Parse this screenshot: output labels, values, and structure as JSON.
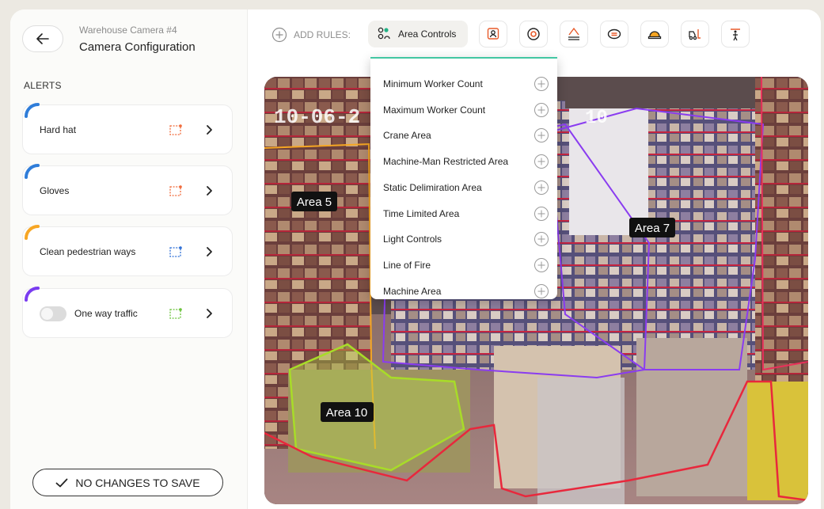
{
  "header": {
    "camera_name": "Warehouse Camera #4",
    "title": "Camera Configuration"
  },
  "sidebar": {
    "section_title": "ALERTS",
    "alerts": [
      {
        "label": "Hard hat",
        "accent": "#2f7dd9",
        "zone_color": "#f06a3a"
      },
      {
        "label": "Gloves",
        "accent": "#2f7dd9",
        "zone_color": "#f06a3a"
      },
      {
        "label": "Clean pedestrian ways",
        "accent": "#f7a623",
        "zone_color": "#2e6fd6"
      },
      {
        "label": "One way traffic",
        "accent": "#7a3cf0",
        "zone_color": "#6ac23a",
        "toggle": "off"
      }
    ],
    "save_label": "NO CHANGES TO SAVE"
  },
  "toolbar": {
    "add_rules_label": "ADD RULES:",
    "active_label": "Area Controls",
    "icons": [
      "worker-badge-icon",
      "eye-detection-icon",
      "crane-icon",
      "restricted-eye-icon",
      "hard-hat-icon",
      "forklift-icon",
      "pedestrian-sign-icon"
    ]
  },
  "dropdown": {
    "items": [
      "Minimum Worker Count",
      "Maximum Worker Count",
      "Crane Area",
      "Machine-Man Restricted Area",
      "Static Delimiration Area",
      "Time Limited Area",
      "Light Controls",
      "Line of Fire",
      "Machine Area"
    ]
  },
  "video": {
    "timestamp": "10-06-2",
    "overlay_number": "10",
    "areas": [
      {
        "label": "Area 5",
        "color": "#f5a623"
      },
      {
        "label": "Area 7",
        "color": "#8a3cf0"
      },
      {
        "label": "Area 10",
        "color": "#a8dc28"
      }
    ],
    "colors": {
      "red_zone": "#e8283c",
      "pink_zone": "#e8315a"
    }
  }
}
